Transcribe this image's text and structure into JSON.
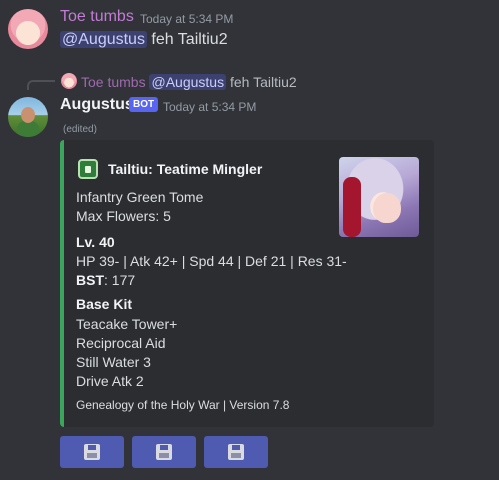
{
  "message1": {
    "username": "Toe tumbs",
    "timestamp": "Today at 5:34 PM",
    "mention": "@Augustus",
    "text": " feh Tailtiu2"
  },
  "reply": {
    "username": "Toe tumbs",
    "mention": "@Augustus",
    "text": "feh Tailtiu2"
  },
  "message2": {
    "username": "Augustus",
    "bot_tag": "BOT",
    "timestamp": "Today at 5:34 PM",
    "edited": "(edited)"
  },
  "embed": {
    "accent_color": "#3ba55c",
    "icon": "green-tome-icon",
    "title": "Tailtiu: Teatime Mingler",
    "lines_intro": [
      "Infantry Green Tome",
      "Max Flowers: 5"
    ],
    "level": "Lv. 40",
    "stats": "HP 39- | Atk 42+ | Spd 44 | Def 21 | Res 31-",
    "bst_label": "BST",
    "bst_value": ": 177",
    "kit_heading": "Base Kit",
    "kit": [
      "Teacake Tower+",
      "Reciprocal Aid",
      "Still Water 3",
      "Drive Atk 2"
    ],
    "footer": "Genealogy of the Holy War | Version 7.8"
  },
  "buttons": [
    {
      "icon": "floppy-disk-icon"
    },
    {
      "icon": "floppy-disk-icon"
    },
    {
      "icon": "floppy-disk-icon"
    }
  ]
}
